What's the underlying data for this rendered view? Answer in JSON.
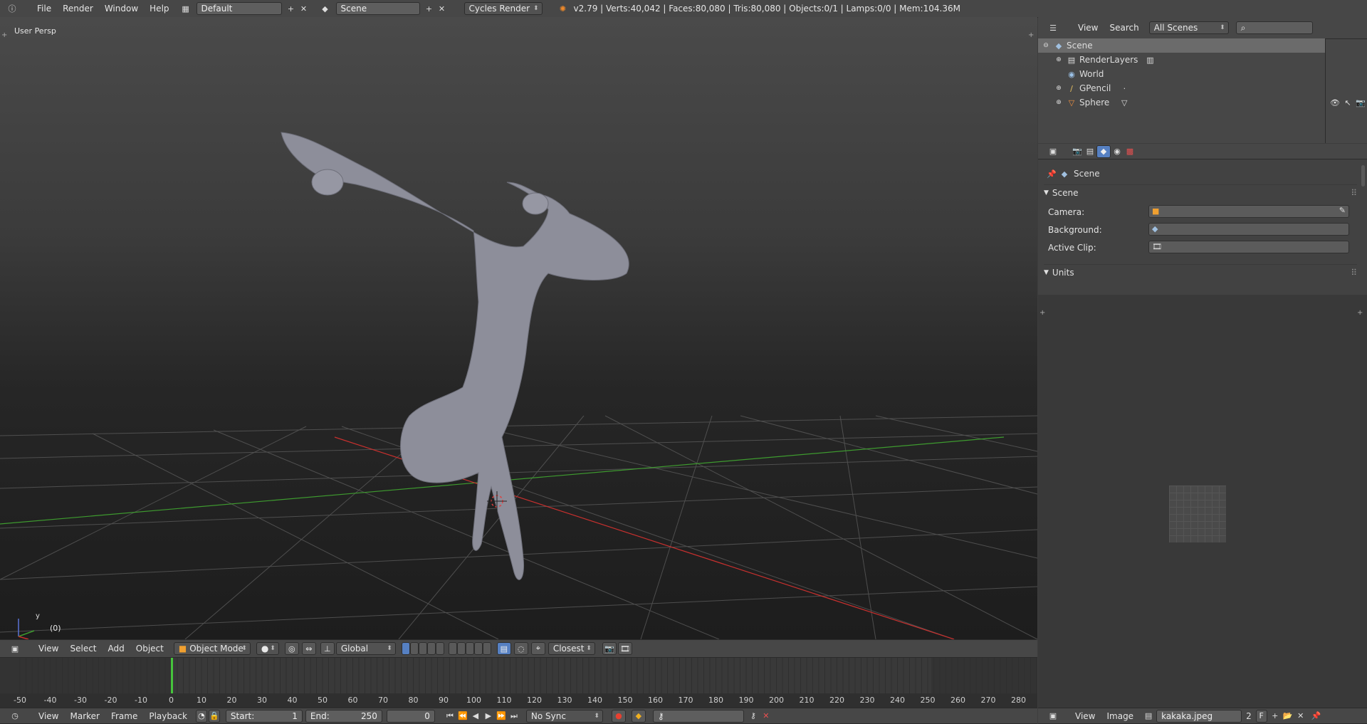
{
  "topbar": {
    "menus": [
      "File",
      "Render",
      "Window",
      "Help"
    ],
    "layout_name": "Default",
    "scene_name": "Scene",
    "engine": "Cycles Render",
    "stats": "v2.79 | Verts:40,042 | Faces:80,080 | Tris:80,080 | Objects:0/1 | Lamps:0/0 | Mem:104.36M"
  },
  "viewport": {
    "view_name": "User Persp",
    "frame_indicator": "(0)",
    "axis_y": "y"
  },
  "viewport_header": {
    "menus": [
      "View",
      "Select",
      "Add",
      "Object"
    ],
    "mode": "Object Mode",
    "orientation": "Global",
    "snap_target": "Closest"
  },
  "outliner": {
    "menus": [
      "View",
      "Search"
    ],
    "display_mode": "All Scenes",
    "items": [
      {
        "label": "Scene",
        "icon": "scene-icon"
      },
      {
        "label": "RenderLayers",
        "icon": "render-layers-icon"
      },
      {
        "label": "World",
        "icon": "world-icon"
      },
      {
        "label": "GPencil",
        "icon": "grease-pencil-icon"
      },
      {
        "label": "Sphere",
        "icon": "mesh-icon"
      }
    ]
  },
  "properties": {
    "context": "Scene",
    "panel_scene": "Scene",
    "camera_label": "Camera:",
    "background_label": "Background:",
    "active_clip_label": "Active Clip:",
    "panel_units": "Units"
  },
  "timeline": {
    "ruler": [
      "-50",
      "-40",
      "-30",
      "-20",
      "-10",
      "0",
      "10",
      "20",
      "30",
      "40",
      "50",
      "60",
      "70",
      "80",
      "90",
      "100",
      "110",
      "120",
      "130",
      "140",
      "150",
      "160",
      "170",
      "180",
      "190",
      "200",
      "210",
      "220",
      "230",
      "240",
      "250",
      "260",
      "270",
      "280"
    ],
    "current_frame_position": 0
  },
  "timeline_header": {
    "menus": [
      "View",
      "Marker",
      "Frame",
      "Playback"
    ],
    "start_label": "Start:",
    "start_value": "1",
    "end_label": "End:",
    "end_value": "250",
    "current_frame": "0",
    "sync": "No Sync"
  },
  "image_editor": {
    "menus": [
      "View",
      "Image"
    ],
    "image_name": "kakaka.jpeg",
    "users": "2",
    "fake_user": "F"
  },
  "colors": {
    "accent": "#5680c2",
    "frame_cursor": "#46c43c",
    "x_axis": "#c8302e",
    "y_axis": "#3e9b2f"
  }
}
